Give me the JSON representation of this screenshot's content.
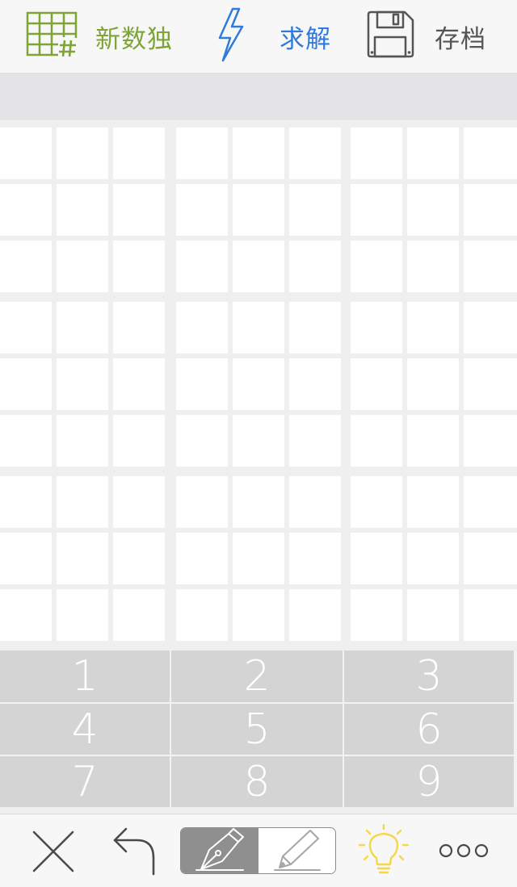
{
  "toolbar": {
    "new_label": "新数独",
    "solve_label": "求解",
    "save_label": "存档",
    "new_icon": "sudoku-grid-icon",
    "solve_icon": "lightning-icon",
    "save_icon": "floppy-disk-icon"
  },
  "colors": {
    "new_accent": "#7da434",
    "solve_accent": "#2e7bdc",
    "hint_accent": "#f5d84a"
  },
  "board": {
    "size": 9,
    "cells": [
      [
        "",
        "",
        "",
        "",
        "",
        "",
        "",
        "",
        ""
      ],
      [
        "",
        "",
        "",
        "",
        "",
        "",
        "",
        "",
        ""
      ],
      [
        "",
        "",
        "",
        "",
        "",
        "",
        "",
        "",
        ""
      ],
      [
        "",
        "",
        "",
        "",
        "",
        "",
        "",
        "",
        ""
      ],
      [
        "",
        "",
        "",
        "",
        "",
        "",
        "",
        "",
        ""
      ],
      [
        "",
        "",
        "",
        "",
        "",
        "",
        "",
        "",
        ""
      ],
      [
        "",
        "",
        "",
        "",
        "",
        "",
        "",
        "",
        ""
      ],
      [
        "",
        "",
        "",
        "",
        "",
        "",
        "",
        "",
        ""
      ],
      [
        "",
        "",
        "",
        "",
        "",
        "",
        "",
        "",
        ""
      ]
    ]
  },
  "keypad": {
    "keys": [
      "1",
      "2",
      "3",
      "4",
      "5",
      "6",
      "7",
      "8",
      "9"
    ]
  },
  "bottombar": {
    "clear_icon": "close-icon",
    "undo_icon": "undo-icon",
    "pen_mode_icon": "pen-nib-icon",
    "pencil_mode_icon": "pencil-icon",
    "hint_icon": "lightbulb-icon",
    "more_icon": "more-dots-icon",
    "mode_selected": "pen"
  }
}
